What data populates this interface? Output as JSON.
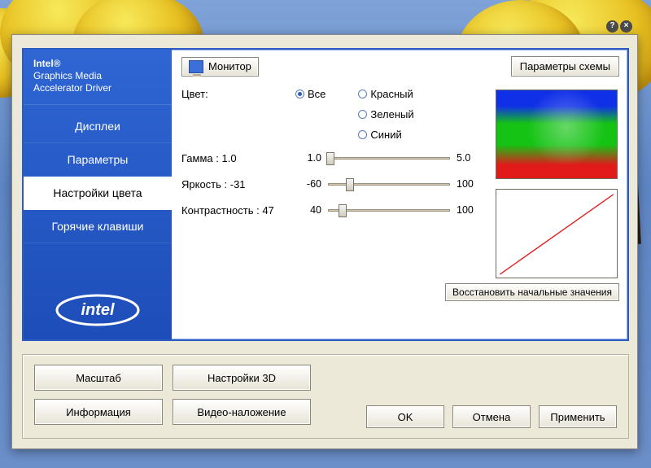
{
  "brand": {
    "line1": "Intel®",
    "line2": "Graphics Media",
    "line3": "Accelerator Driver"
  },
  "sidebar": {
    "items": [
      {
        "label": "Дисплеи"
      },
      {
        "label": "Параметры"
      },
      {
        "label": "Настройки цвета"
      },
      {
        "label": "Горячие клавиши"
      }
    ],
    "active_index": 2
  },
  "header": {
    "monitor_tab": "Монитор",
    "scheme_btn": "Параметры схемы"
  },
  "color": {
    "label": "Цвет:",
    "options": {
      "all": "Все",
      "red": "Красный",
      "green": "Зеленый",
      "blue": "Синий"
    },
    "selected": "all"
  },
  "gamma": {
    "label": "Гамма : 1.0",
    "min": "1.0",
    "max": "5.0",
    "pos_pct": 2
  },
  "brightness": {
    "label": "Яркость : -31",
    "min": "-60",
    "max": "100",
    "pos_pct": 18
  },
  "contrast": {
    "label": "Контрастность : 47",
    "min": "40",
    "max": "100",
    "pos_pct": 12
  },
  "restore_btn": "Восстановить начальные значения",
  "lower": {
    "scale": "Масштаб",
    "settings3d": "Настройки 3D",
    "info": "Информация",
    "overlay": "Видео-наложение"
  },
  "footer": {
    "ok": "OK",
    "cancel": "Отмена",
    "apply": "Применить"
  }
}
